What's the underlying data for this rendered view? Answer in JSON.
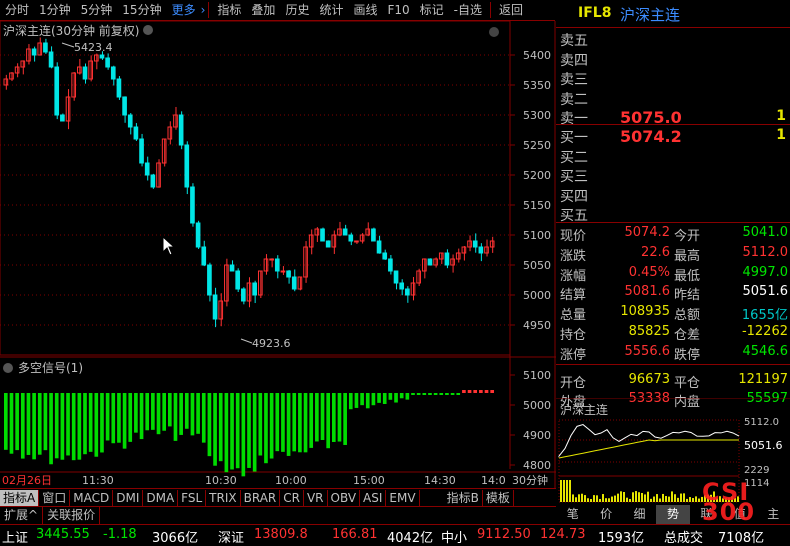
{
  "toolbar": {
    "tabs": [
      "分时",
      "1分钟",
      "5分钟",
      "15分钟",
      "更多",
      "指标",
      "叠加",
      "历史",
      "统计",
      "画线",
      "F10",
      "标记",
      "-自选",
      "返回"
    ]
  },
  "contract": {
    "code": "IFL8",
    "name": "沪深主连"
  },
  "chart": {
    "title": "沪深主连(30分钟 前复权)",
    "high_label": "5423.4",
    "low_label": "4923.6",
    "y_ticks": [
      "5400",
      "5350",
      "5300",
      "5250",
      "5200",
      "5150",
      "5100",
      "5050",
      "5000",
      "4950"
    ],
    "indicator_title": "多空信号(1)",
    "ind_ticks": [
      "5100",
      "5000",
      "4900",
      "4800"
    ],
    "x_ticks": [
      "02月26日",
      "11:30",
      "10:30",
      "10:00",
      "15:00",
      "14:30",
      "14:0"
    ],
    "period": "30分钟",
    "colors": {
      "up": "#ff3232",
      "down": "#00e6e6",
      "bar": "#00dc00",
      "bar_red": "#ff3232",
      "grid": "#800000"
    }
  },
  "orderbook": {
    "asks": [
      {
        "label": "卖五",
        "price": "",
        "vol": ""
      },
      {
        "label": "卖四",
        "price": "",
        "vol": ""
      },
      {
        "label": "卖三",
        "price": "",
        "vol": ""
      },
      {
        "label": "卖二",
        "price": "",
        "vol": ""
      },
      {
        "label": "卖一",
        "price": "5075.0",
        "vol": "1"
      }
    ],
    "bids": [
      {
        "label": "买一",
        "price": "5074.2",
        "vol": "1"
      },
      {
        "label": "买二",
        "price": "",
        "vol": ""
      },
      {
        "label": "买三",
        "price": "",
        "vol": ""
      },
      {
        "label": "买四",
        "price": "",
        "vol": ""
      },
      {
        "label": "买五",
        "price": "",
        "vol": ""
      }
    ]
  },
  "stats": [
    {
      "l1": "现价",
      "v1": "5074.2",
      "c1": "red",
      "l2": "今开",
      "v2": "5041.0",
      "c2": "green"
    },
    {
      "l1": "涨跌",
      "v1": "22.6",
      "c1": "red",
      "l2": "最高",
      "v2": "5112.0",
      "c2": "red"
    },
    {
      "l1": "涨幅",
      "v1": "0.45%",
      "c1": "red",
      "l2": "最低",
      "v2": "4997.0",
      "c2": "green"
    },
    {
      "l1": "结算",
      "v1": "5081.6",
      "c1": "red",
      "l2": "昨结",
      "v2": "5051.6",
      "c2": "white"
    },
    {
      "l1": "总量",
      "v1": "108935",
      "c1": "yellow",
      "l2": "总额",
      "v2": "1655亿",
      "c2": "cyan"
    },
    {
      "l1": "持仓",
      "v1": "85825",
      "c1": "yellow",
      "l2": "仓差",
      "v2": "-12262",
      "c2": "yellow"
    },
    {
      "l1": "涨停",
      "v1": "5556.6",
      "c1": "red",
      "l2": "跌停",
      "v2": "4546.6",
      "c2": "green"
    },
    {
      "l1": "开仓",
      "v1": "96673",
      "c1": "yellow",
      "l2": "平仓",
      "v2": "121197",
      "c2": "yellow"
    },
    {
      "l1": "外盘",
      "v1": "53338",
      "c1": "red",
      "l2": "内盘",
      "v2": "55597",
      "c2": "green"
    }
  ],
  "mini": {
    "title": "沪深主连",
    "high": "5112.0",
    "mid": "5051.6",
    "vol1": "2229",
    "vol2": "1114"
  },
  "bottom_tabs": [
    "指标A",
    "窗口",
    "MACD",
    "DMI",
    "DMA",
    "FSL",
    "TRIX",
    "BRAR",
    "CR",
    "VR",
    "OBV",
    "ASI",
    "EMV",
    "",
    "指标B",
    "模板"
  ],
  "bottom_row2": [
    "扩展^",
    "关联报价"
  ],
  "right_tabs": [
    "笔",
    "价",
    "细",
    "势",
    "联",
    "值",
    "主"
  ],
  "ticker": {
    "sh_label": "上证",
    "sh_val": "3445.55",
    "sh_chg": "-1.18",
    "sh_amt": "3066亿",
    "sz_label": "深证",
    "sz_val": "13809.8",
    "sz_chg": "166.81",
    "sz_amt": "4042亿",
    "zx_label": "中小",
    "zx_val": "9112.50",
    "zx_chg": "124.73",
    "zx_amt": "1593亿",
    "total_label": "总成交",
    "total_val": "7108亿"
  },
  "watermark": "CSI 300"
}
